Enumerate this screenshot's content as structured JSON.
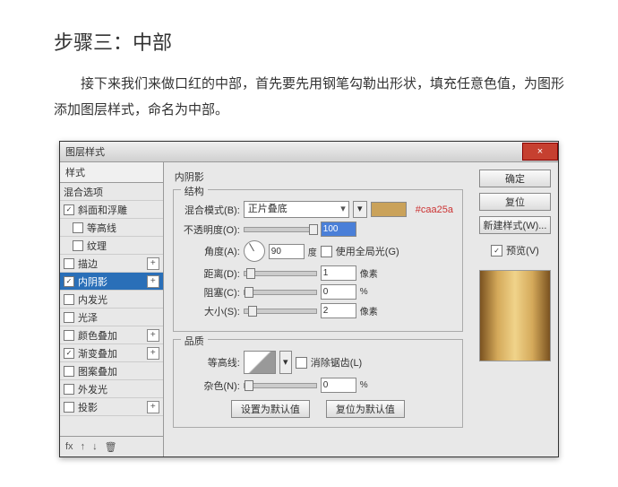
{
  "doc": {
    "heading": "步骤三：中部",
    "paragraph": "接下来我们来做口红的中部，首先要先用钢笔勾勒出形状，填充任意色值，为图形添加图层样式，命名为中部。"
  },
  "dialog": {
    "title": "图层样式",
    "close_icon": "×"
  },
  "sidebar": {
    "header": "样式",
    "items": [
      {
        "label": "混合选项",
        "checkbox": false,
        "level": 1
      },
      {
        "label": "斜面和浮雕",
        "checkbox": true,
        "checked": true,
        "level": 1
      },
      {
        "label": "等高线",
        "checkbox": true,
        "checked": false,
        "level": 2
      },
      {
        "label": "纹理",
        "checkbox": true,
        "checked": false,
        "level": 2
      },
      {
        "label": "描边",
        "checkbox": true,
        "checked": false,
        "level": 1,
        "plus": true
      },
      {
        "label": "内阴影",
        "checkbox": true,
        "checked": true,
        "level": 1,
        "selected": true,
        "plus": true
      },
      {
        "label": "内发光",
        "checkbox": true,
        "checked": false,
        "level": 1
      },
      {
        "label": "光泽",
        "checkbox": true,
        "checked": false,
        "level": 1
      },
      {
        "label": "颜色叠加",
        "checkbox": true,
        "checked": false,
        "level": 1,
        "plus": true
      },
      {
        "label": "渐变叠加",
        "checkbox": true,
        "checked": true,
        "level": 1,
        "plus": true
      },
      {
        "label": "图案叠加",
        "checkbox": true,
        "checked": false,
        "level": 1
      },
      {
        "label": "外发光",
        "checkbox": true,
        "checked": false,
        "level": 1
      },
      {
        "label": "投影",
        "checkbox": true,
        "checked": false,
        "level": 1,
        "plus": true
      }
    ],
    "footer": {
      "fx": "fx",
      "up": "↑",
      "down": "↓",
      "trash": "🗑"
    }
  },
  "panel": {
    "group1_title": "内阴影",
    "struct_label": "结构",
    "blend_label": "混合模式(B):",
    "blend_value": "正片叠底",
    "color_hex": "#caa25a",
    "opacity_label": "不透明度(O):",
    "opacity_value": "100",
    "angle_label": "角度(A):",
    "angle_value": "90",
    "angle_unit": "度",
    "global_label": "使用全局光(G)",
    "global_checked": false,
    "distance_label": "距离(D):",
    "distance_value": "1",
    "distance_unit": "像素",
    "choke_label": "阻塞(C):",
    "choke_value": "0",
    "choke_unit": "%",
    "size_label": "大小(S):",
    "size_value": "2",
    "size_unit": "像素",
    "group2_title": "品质",
    "contour_label": "等高线:",
    "anti_label": "消除锯齿(L)",
    "anti_checked": false,
    "noise_label": "杂色(N):",
    "noise_value": "0",
    "noise_unit": "%",
    "btn_default": "设置为默认值",
    "btn_reset": "复位为默认值"
  },
  "right": {
    "ok": "确定",
    "cancel": "复位",
    "newstyle": "新建样式(W)...",
    "preview_label": "预览(V)",
    "preview_checked": true
  }
}
